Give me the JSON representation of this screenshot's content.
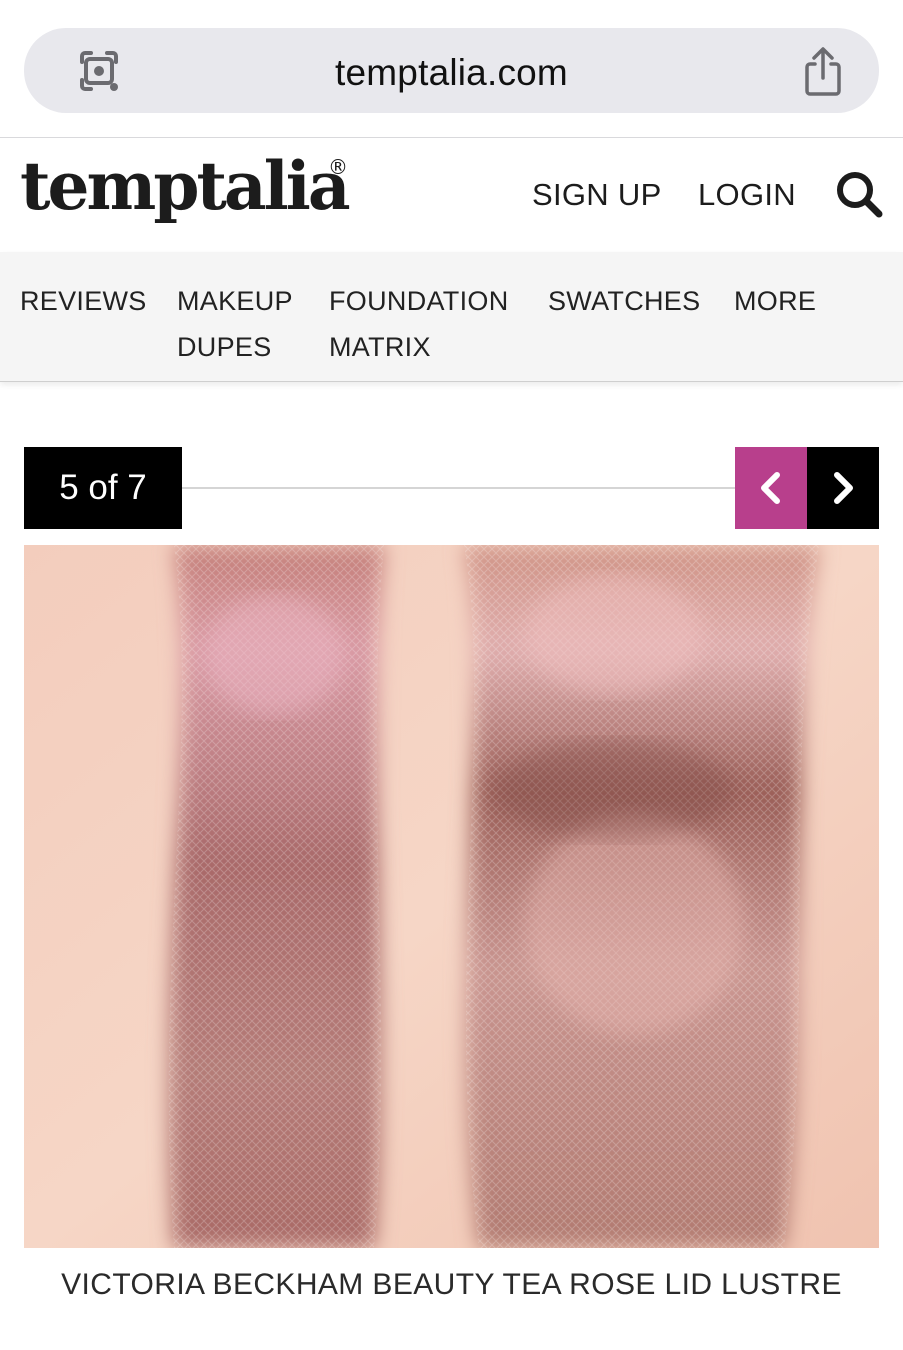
{
  "browser": {
    "url": "temptalia.com",
    "icons": [
      "visual-lookup-icon",
      "share-icon"
    ]
  },
  "header": {
    "logo": "temptalia",
    "registered_mark": "®",
    "signup_label": "SIGN UP",
    "login_label": "LOGIN",
    "search_icon": "search-icon"
  },
  "nav": {
    "items": [
      {
        "line1": "REVIEWS",
        "line2": ""
      },
      {
        "line1": "MAKEUP",
        "line2": "DUPES"
      },
      {
        "line1": "FOUNDATION",
        "line2": "MATRIX"
      },
      {
        "line1": "SWATCHES",
        "line2": ""
      },
      {
        "line1": "MORE",
        "line2": ""
      }
    ]
  },
  "gallery": {
    "counter": "5 of 7",
    "prev_icon": "chevron-left-icon",
    "next_icon": "chevron-right-icon",
    "accent_color": "#b83f8c",
    "caption": "VICTORIA BECKHAM BEAUTY TEA ROSE LID LUSTRE"
  }
}
